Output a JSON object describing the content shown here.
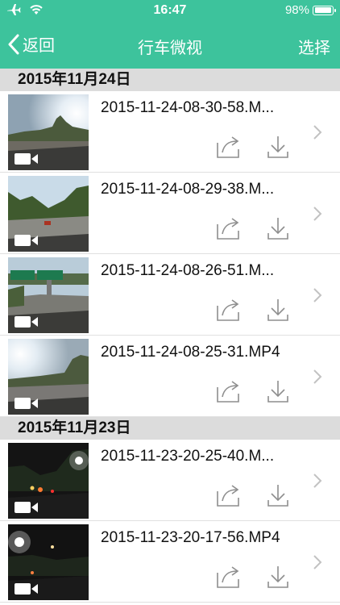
{
  "status": {
    "time": "16:47",
    "battery": "98%",
    "battery_level": 0.98
  },
  "nav": {
    "back_label": "返回",
    "title": "行车微视",
    "select_label": "选择"
  },
  "sections": [
    {
      "date": "2015年11月24日",
      "items": [
        {
          "filename": "2015-11-24-08-30-58.M...",
          "scene": "sun"
        },
        {
          "filename": "2015-11-24-08-29-38.M...",
          "scene": "trees"
        },
        {
          "filename": "2015-11-24-08-26-51.M...",
          "scene": "sign"
        },
        {
          "filename": "2015-11-24-08-25-31.MP4",
          "scene": "sun2"
        }
      ]
    },
    {
      "date": "2015年11月23日",
      "items": [
        {
          "filename": "2015-11-23-20-25-40.M...",
          "scene": "night"
        },
        {
          "filename": "2015-11-23-20-17-56.MP4",
          "scene": "night2"
        }
      ]
    }
  ],
  "icons": {
    "airplane": "airplane-icon",
    "wifi": "wifi-icon",
    "back": "chevron-left-icon",
    "video": "video-camera-icon",
    "share": "share-icon",
    "download": "download-icon",
    "chevron": "chevron-right-icon"
  },
  "colors": {
    "accent": "#3dc39c",
    "section_bg": "#dcdcdc"
  }
}
